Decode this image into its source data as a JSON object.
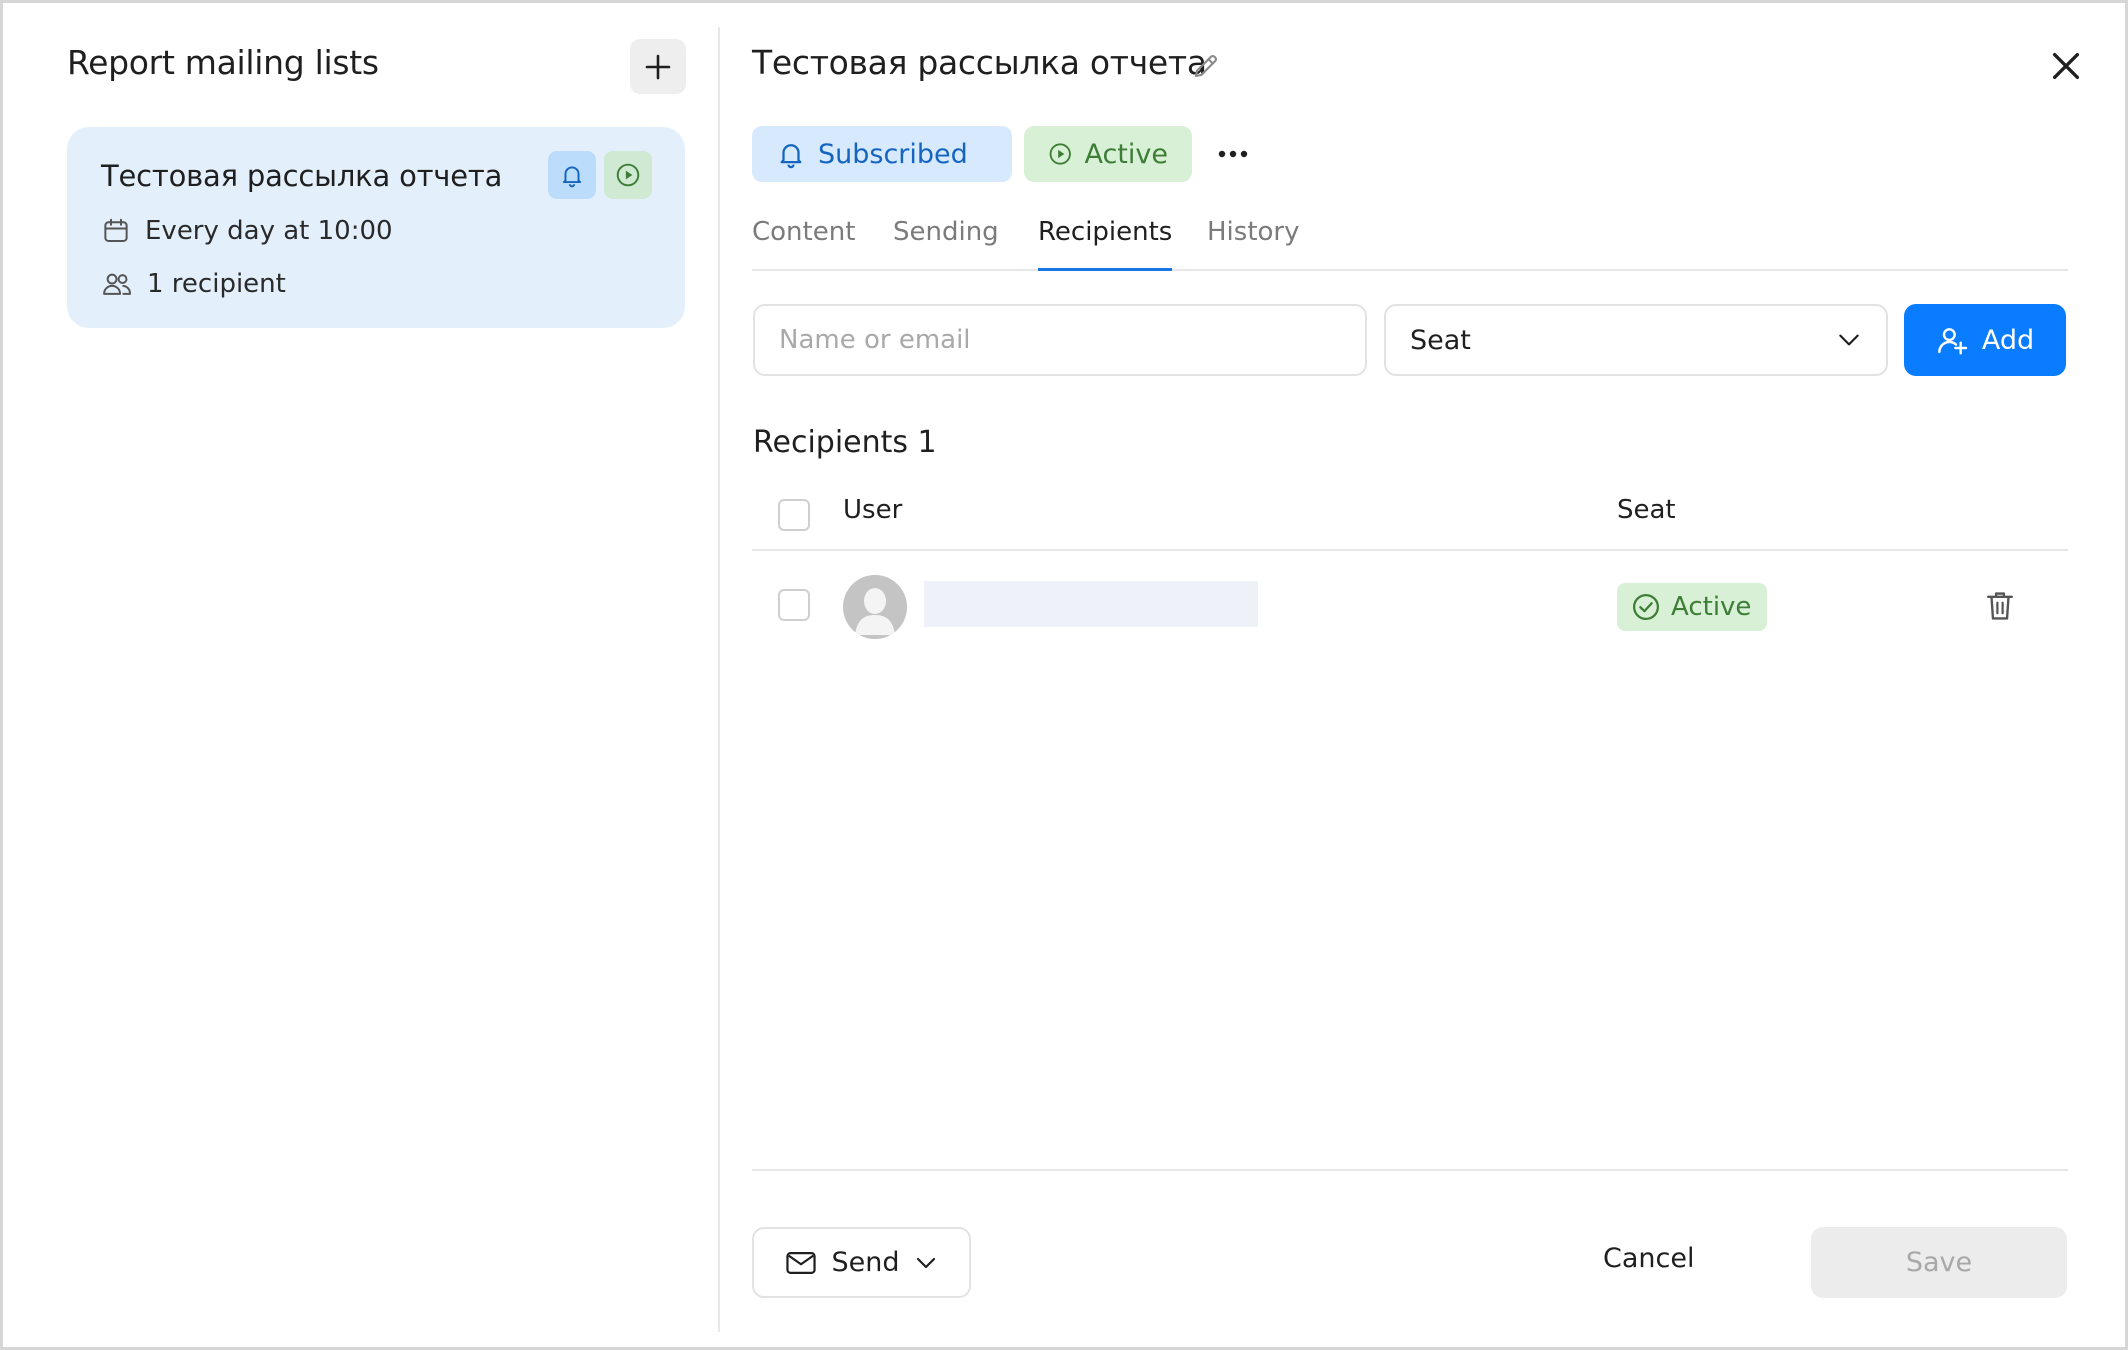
{
  "left": {
    "title": "Report mailing lists",
    "card": {
      "title": "Тестовая рассылка отчета",
      "schedule": "Every day at 10:00",
      "recipients": "1 recipient"
    }
  },
  "detail": {
    "title": "Тестовая рассылка отчета",
    "chips": {
      "subscribed": "Subscribed",
      "active": "Active"
    },
    "tabs": [
      "Content",
      "Sending",
      "Recipients",
      "History"
    ],
    "active_tab": "Recipients",
    "search": {
      "placeholder": "Name or email"
    },
    "seat_select": {
      "value": "Seat"
    },
    "add_label": "Add",
    "recipients_title": "Recipients 1",
    "table": {
      "columns": [
        "User",
        "Seat"
      ],
      "rows": [
        {
          "user": "",
          "status": "Active"
        }
      ]
    },
    "footer": {
      "send_label": "Send",
      "cancel_label": "Cancel",
      "save_label": "Save"
    }
  },
  "colors": {
    "accent": "#0a7cff",
    "subscribed_bg": "#d6e9fd",
    "active_bg": "#d8f0d6",
    "card_bg": "#e3f0fc"
  }
}
